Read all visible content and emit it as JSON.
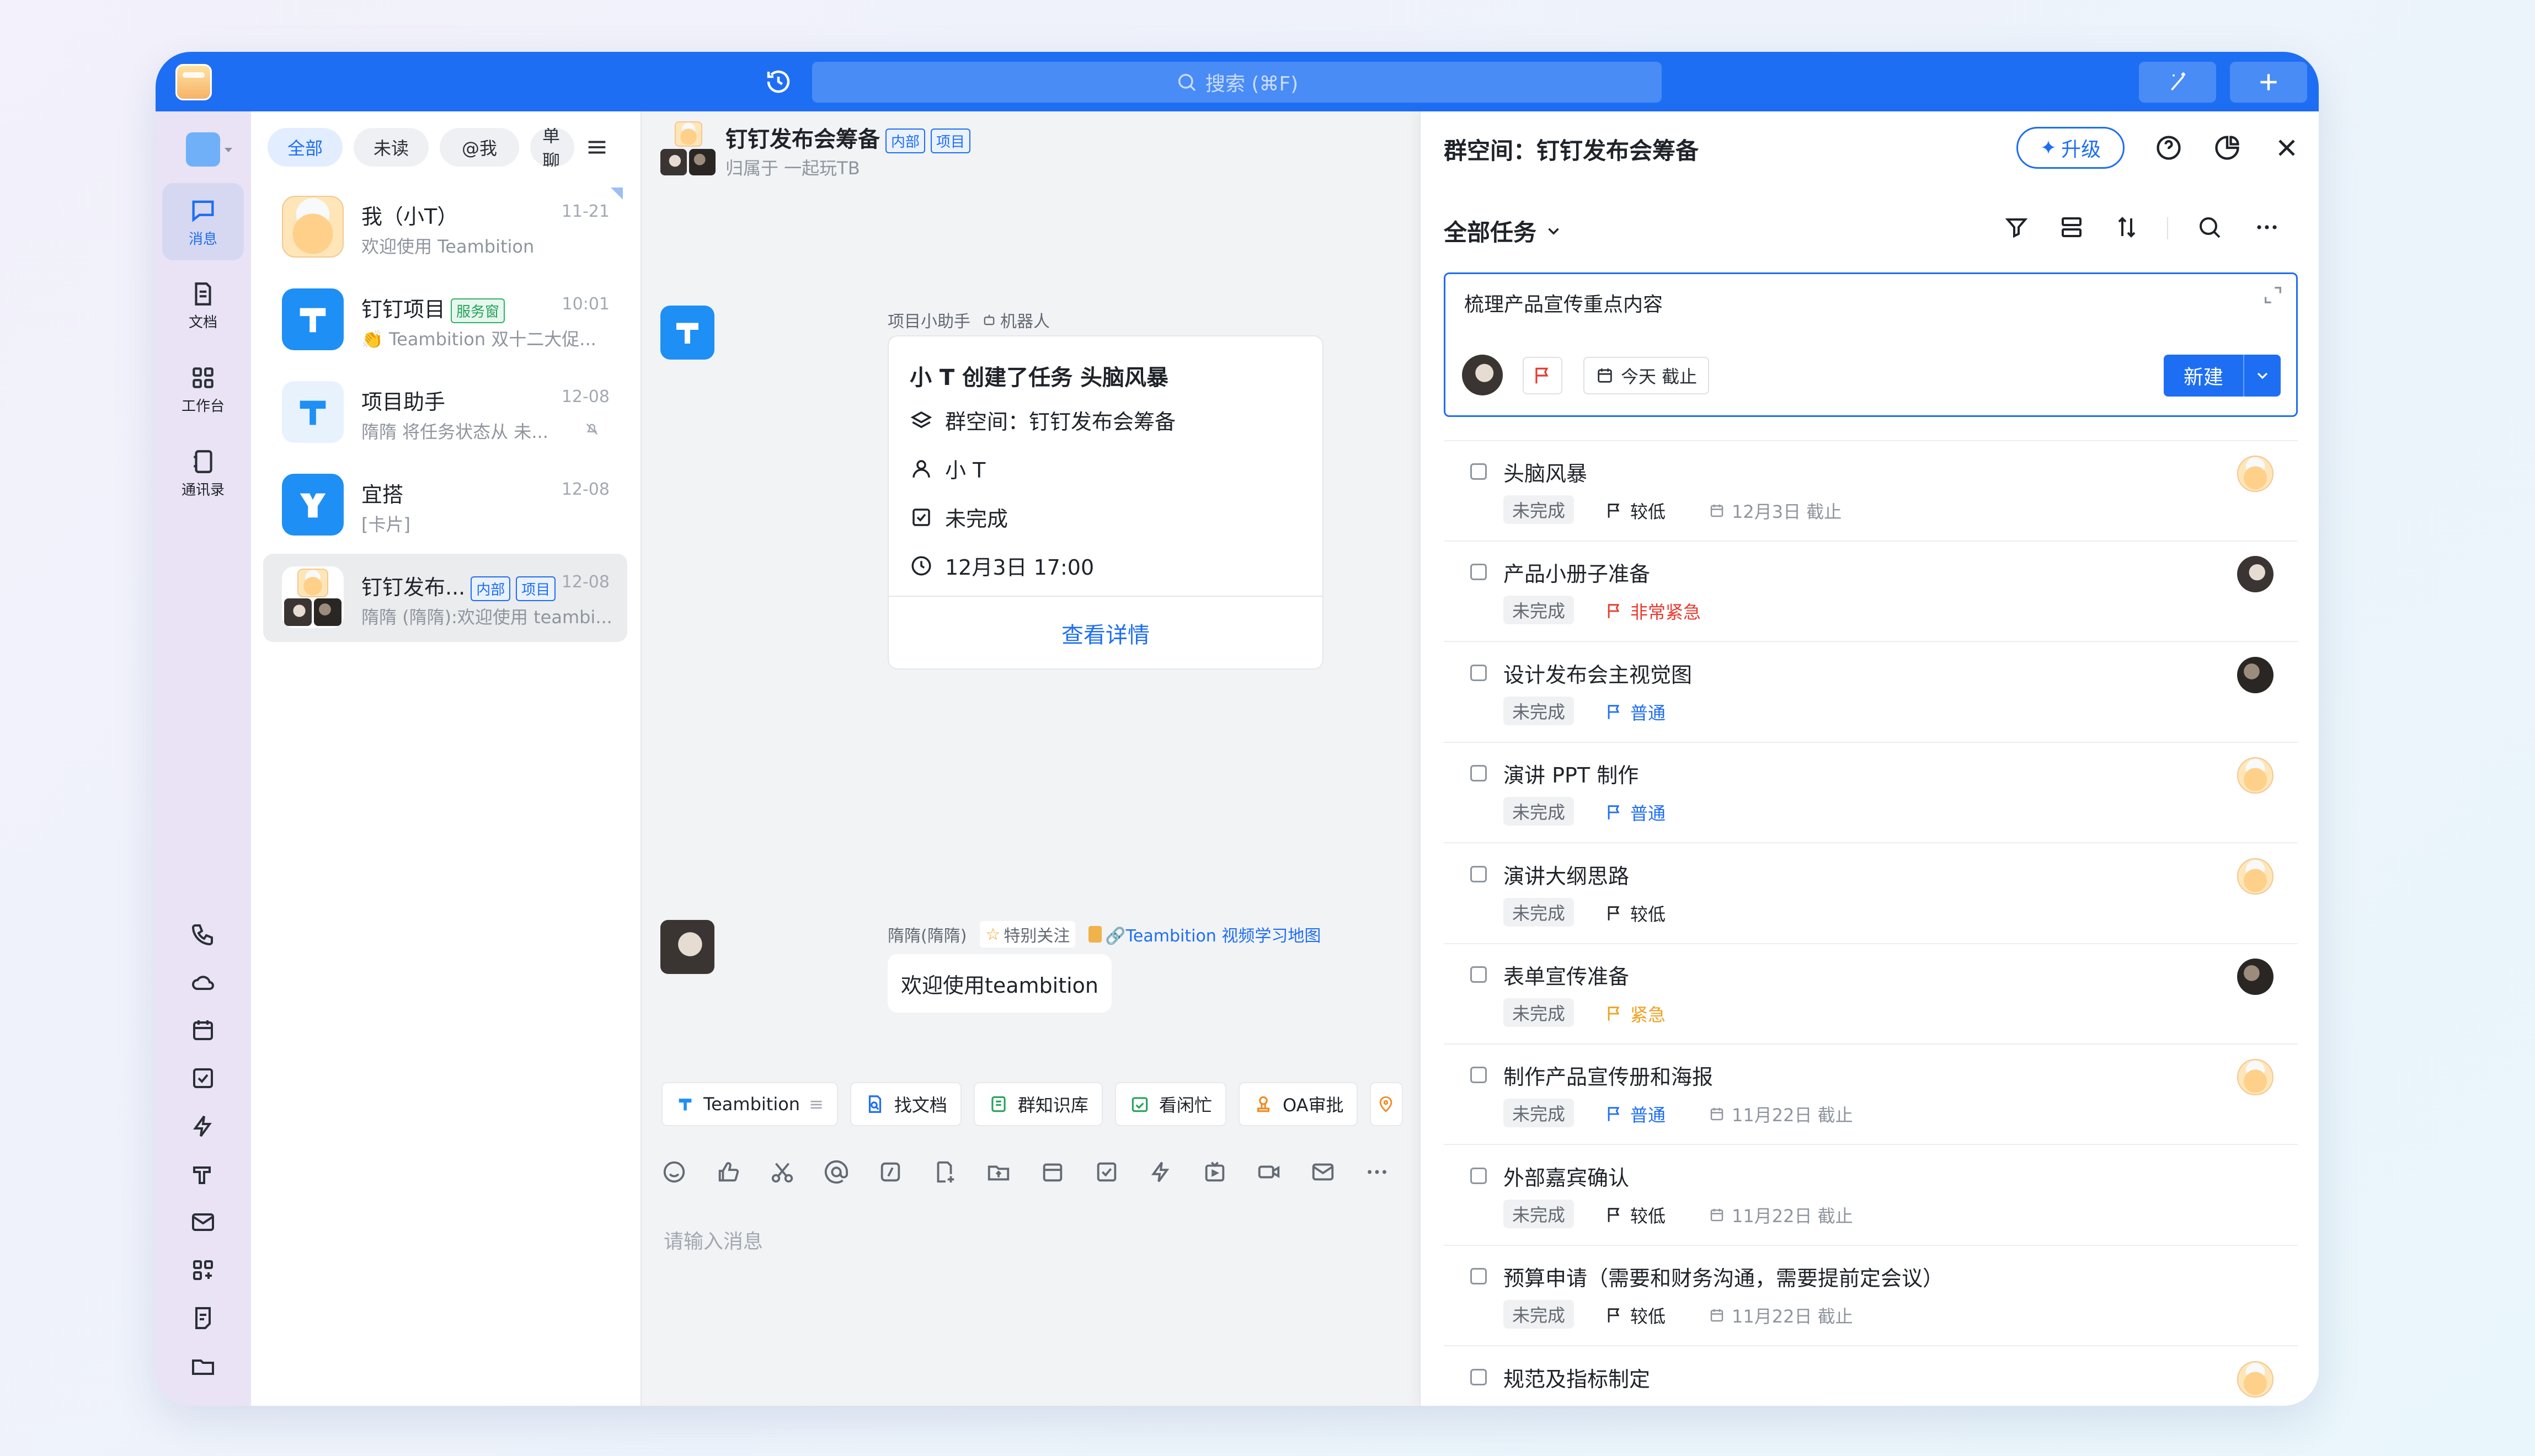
{
  "titlebar": {
    "search_placeholder": "搜索 (⌘F)"
  },
  "nav": {
    "items": [
      {
        "label": "消息"
      },
      {
        "label": "文档"
      },
      {
        "label": "工作台"
      },
      {
        "label": "通讯录"
      }
    ]
  },
  "conv_list": {
    "filters": [
      "全部",
      "未读",
      "@我",
      "单聊"
    ],
    "items": [
      {
        "title": "我（小T）",
        "preview": "欢迎使用 Teambition",
        "time": "11-21"
      },
      {
        "title": "钉钉项目",
        "tag": "服务窗",
        "preview": "👏 Teambition 双十二大促...",
        "time": "10:01"
      },
      {
        "title": "项目助手",
        "preview": "隋隋 将任务状态从 未...",
        "time": "12-08"
      },
      {
        "title": "宜搭",
        "preview": "[卡片]",
        "time": "12-08"
      },
      {
        "title": "钉钉发布...",
        "tags": [
          "内部",
          "项目"
        ],
        "preview": "隋隋 (隋隋):欢迎使用 teambi...",
        "time": "12-08"
      }
    ]
  },
  "chat": {
    "title": "钉钉发布会筹备",
    "tags": [
      "内部",
      "项目"
    ],
    "subtitle": "归属于 一起玩TB",
    "bot": {
      "sender": "项目小助手",
      "badge": "机器人",
      "card_title": "小 T 创建了任务 头脑风暴",
      "space": "群空间：钉钉发布会筹备",
      "assignee": "小 T",
      "status": "未完成",
      "due": "12月3日 17:00",
      "action": "查看详情"
    },
    "msg": {
      "sender": "隋隋(隋隋)",
      "follow": "特别关注",
      "link": "🔗Teambition 视频学习地图",
      "text": "欢迎使用teambition"
    },
    "tools": [
      "Teambition",
      "找文档",
      "群知识库",
      "看闲忙",
      "OA审批"
    ],
    "input_placeholder": "请输入消息"
  },
  "panel": {
    "title": "群空间：钉钉发布会筹备",
    "upgrade": "升级",
    "view": "全部任务",
    "editor_text": "梳理产品宣传重点内容",
    "due_chip": "今天 截止",
    "new_btn": "新建",
    "tasks": [
      {
        "name": "头脑风暴",
        "status": "未完成",
        "priority": "较低",
        "prio_color": "#1f2329",
        "due": "12月3日 截止",
        "avatar": "face"
      },
      {
        "name": "产品小册子准备",
        "status": "未完成",
        "priority": "非常紧急",
        "prio_color": "#e8392f",
        "due": "",
        "avatar": "dark"
      },
      {
        "name": "设计发布会主视觉图",
        "status": "未完成",
        "priority": "普通",
        "prio_color": "#1e6ef4",
        "due": "",
        "avatar": "dark2"
      },
      {
        "name": "演讲 PPT 制作",
        "status": "未完成",
        "priority": "普通",
        "prio_color": "#1e6ef4",
        "due": "",
        "avatar": "face"
      },
      {
        "name": "演讲大纲思路",
        "status": "未完成",
        "priority": "较低",
        "prio_color": "#1f2329",
        "due": "",
        "avatar": "face"
      },
      {
        "name": "表单宣传准备",
        "status": "未完成",
        "priority": "紧急",
        "prio_color": "#f0a020",
        "due": "",
        "avatar": "dark2"
      },
      {
        "name": "制作产品宣传册和海报",
        "status": "未完成",
        "priority": "普通",
        "prio_color": "#1e6ef4",
        "due": "11月22日 截止",
        "avatar": "face"
      },
      {
        "name": "外部嘉宾确认",
        "status": "未完成",
        "priority": "较低",
        "prio_color": "#1f2329",
        "due": "11月22日 截止",
        "avatar": ""
      },
      {
        "name": "预算申请（需要和财务沟通，需要提前定会议）",
        "status": "未完成",
        "priority": "较低",
        "prio_color": "#1f2329",
        "due": "11月22日 截止",
        "avatar": ""
      },
      {
        "name": "规范及指标制定",
        "status": "",
        "priority": "",
        "prio_color": "#1f2329",
        "due": "",
        "avatar": "face"
      }
    ]
  }
}
